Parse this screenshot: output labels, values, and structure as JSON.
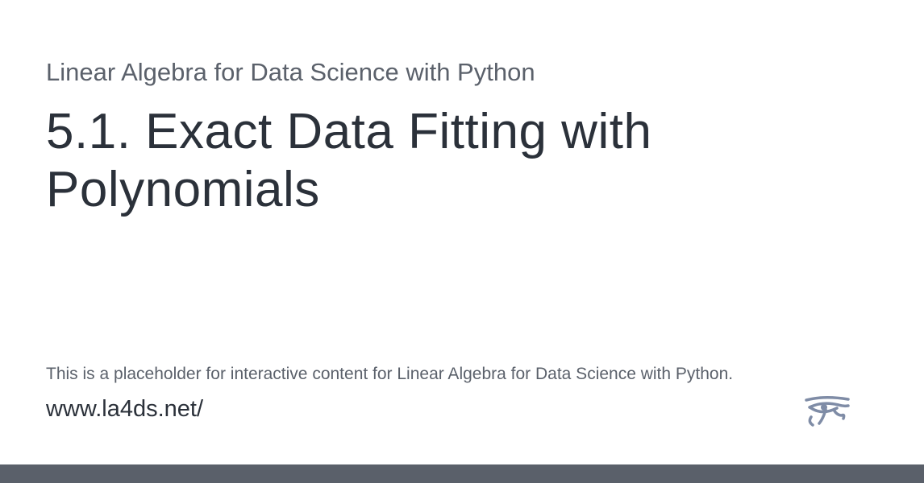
{
  "header": {
    "book_title": "Linear Algebra for Data Science with Python"
  },
  "main": {
    "page_title": "5.1. Exact Data Fitting with Polynomials"
  },
  "footer": {
    "description": "This is a placeholder for interactive content for Linear Algebra for Data Science with Python.",
    "url": "www.la4ds.net/",
    "logo_icon": "eye-of-horus-icon"
  },
  "colors": {
    "title_text": "#2b313a",
    "secondary_text": "#5b616b",
    "logo": "#7f8ca6",
    "footer_bar": "#5a606a"
  }
}
